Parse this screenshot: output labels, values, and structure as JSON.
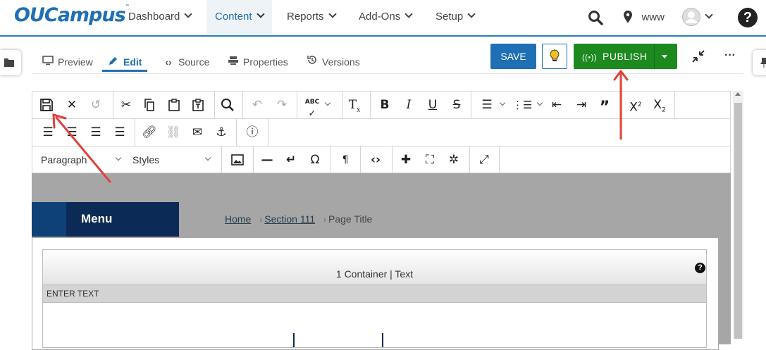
{
  "brand": {
    "logo_text": "OUCampus",
    "logo_tm": "™",
    "brand_color": "#1f6fb5"
  },
  "nav": {
    "items": [
      {
        "label": "Dashboard"
      },
      {
        "label": "Content"
      },
      {
        "label": "Reports"
      },
      {
        "label": "Add-Ons"
      },
      {
        "label": "Setup"
      }
    ],
    "site_label": "www"
  },
  "tabs": [
    {
      "label": "Preview",
      "icon": "monitor-icon"
    },
    {
      "label": "Edit",
      "icon": "pencil-icon"
    },
    {
      "label": "Source",
      "icon": "code-icon"
    },
    {
      "label": "Properties",
      "icon": "sliders-icon"
    },
    {
      "label": "Versions",
      "icon": "history-icon"
    }
  ],
  "actions": {
    "save_label": "SAVE",
    "publish_label": "PUBLISH",
    "publish_color": "#1c8a1f"
  },
  "toolbar": {
    "format_select": "Paragraph",
    "styles_select": "Styles"
  },
  "page": {
    "menu_label": "Menu",
    "breadcrumb": {
      "home": "Home",
      "section": "Section 111",
      "current": "Page Title"
    },
    "container_title": "1 Container | Text",
    "enter_text": "ENTER TEXT"
  },
  "annotations": {
    "arrow_color": "#e0413a"
  }
}
